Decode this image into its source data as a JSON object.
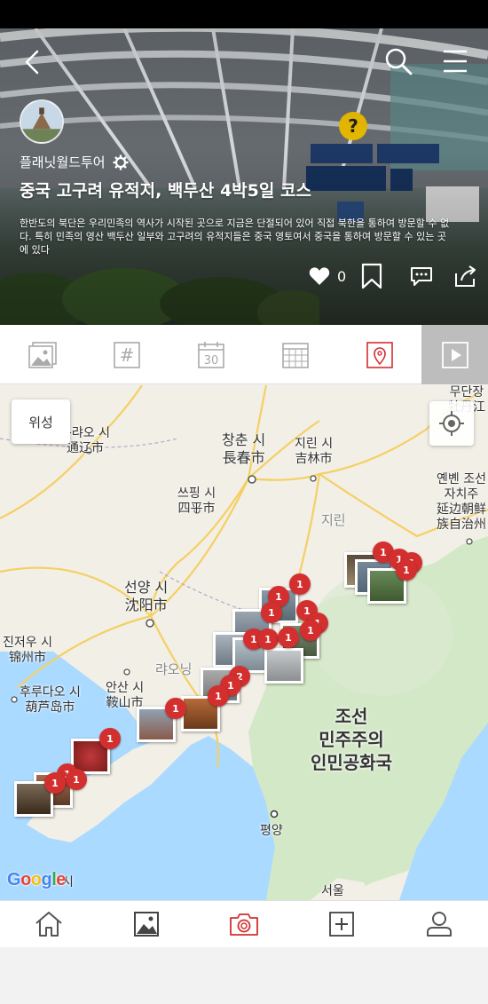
{
  "header": {
    "author": "플래닛월드투어",
    "title": "중국 고구려 유적지, 백두산 4박5일 코스",
    "description": "한반도의 북단은 우리민족의 역사가 시작된 곳으로 지금은 단절되어 있어 직접 북한을 통하여 방문할 수 없다. 특히 민족의 영산 백두산 일부와 고구려의 유적지들은 중국 영토여서 중국을 통하여 방문할 수 있는 곳에 있다",
    "like_count": "0"
  },
  "tabs": [
    {
      "name": "photos",
      "icon": "photo-icon"
    },
    {
      "name": "hashtags",
      "icon": "hashtag-icon"
    },
    {
      "name": "day",
      "icon": "calendar-30-icon",
      "label": "30"
    },
    {
      "name": "calendar",
      "icon": "calendar-grid-icon"
    },
    {
      "name": "map",
      "icon": "map-pin-icon",
      "active": true
    },
    {
      "name": "slideshow",
      "icon": "play-icon"
    }
  ],
  "map": {
    "satellite_label": "위성",
    "labels": {
      "mudanjiang": "무단장\n牡丹江",
      "changchun": "창춘 시\n長春市",
      "jilin_city": "지린 시\n吉林市",
      "yanbian": "옌볜 조선\n자치주\n延边朝鲜\n族自治州",
      "tonghua": "퉁랴오 시\n通辽市",
      "siping": "쓰핑 시\n四平市",
      "jilin_prov": "지린",
      "shenyang": "선양 시\n沈阳市",
      "jinzhou": "진저우 시\n锦州市",
      "liaoning": "랴오닝",
      "anshan": "안산 시\n鞍山市",
      "huludao": "후루다오 시\n葫芦岛市",
      "dprk": "조선\n민주주의\n인민공화국",
      "pyongyang": "평양",
      "seoul": "서울",
      "dalian_frag": "시"
    },
    "pin_label": "1",
    "pin_label_2": "2",
    "google_logo": "Google"
  },
  "bottom_nav": [
    {
      "name": "home",
      "icon": "home-icon"
    },
    {
      "name": "gallery",
      "icon": "image-icon"
    },
    {
      "name": "camera",
      "icon": "camera-icon",
      "active": true
    },
    {
      "name": "add",
      "icon": "add-square-icon"
    },
    {
      "name": "profile",
      "icon": "user-icon"
    }
  ],
  "colors": {
    "accent": "#d32f2f",
    "pin": "#d32f2f",
    "map_land": "#f1efe6",
    "map_sea": "#aadaff",
    "dprk_green": "#cfe8c4",
    "road": "#f7d26b",
    "tab_inactive": "#aaaaaa"
  }
}
